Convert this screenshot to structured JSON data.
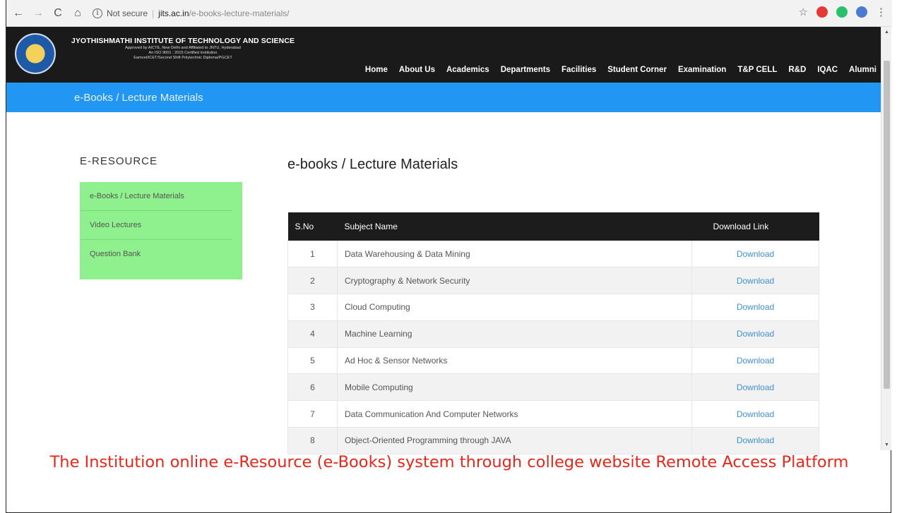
{
  "browser": {
    "security_label": "Not secure",
    "host": "jits.ac.in",
    "path": "/e-books-lecture-materials/"
  },
  "header": {
    "institute_name": "JYOTHISHMATHI INSTITUTE OF TECHNOLOGY AND SCIENCE",
    "lines": [
      "Approved by AICTE, New Delhi and Affiliated to JNTU, Hyderabad",
      "An ISO 9001 : 2015 Certified Institution",
      "Eamcet/ICET/Second Shift Polytechnic Diploma/PGCET"
    ],
    "menu": [
      "Home",
      "About Us",
      "Academics",
      "Departments",
      "Facilities",
      "Student Corner",
      "Examination",
      "T&P CELL",
      "R&D",
      "IQAC",
      "Alumni"
    ]
  },
  "banner": {
    "title": "e-Books / Lecture Materials"
  },
  "sidebar": {
    "title": "E-RESOURCE",
    "items": [
      "e-Books / Lecture Materials",
      "Video Lectures",
      "Question Bank"
    ]
  },
  "main": {
    "title": "e-books / Lecture Materials",
    "columns": [
      "S.No",
      "Subject Name",
      "Download Link"
    ],
    "rows": [
      {
        "no": "1",
        "subject": "Data Warehousing & Data Mining",
        "link": "Download"
      },
      {
        "no": "2",
        "subject": "Cryptography & Network Security",
        "link": "Download"
      },
      {
        "no": "3",
        "subject": "Cloud Computing",
        "link": "Download"
      },
      {
        "no": "4",
        "subject": "Machine Learning",
        "link": "Download"
      },
      {
        "no": "5",
        "subject": "Ad Hoc & Sensor Networks",
        "link": "Download"
      },
      {
        "no": "6",
        "subject": "Mobile Computing",
        "link": "Download"
      },
      {
        "no": "7",
        "subject": "Data Communication And Computer Networks",
        "link": "Download"
      },
      {
        "no": "8",
        "subject": "Object-Oriented Programming through JAVA",
        "link": "Download"
      }
    ]
  },
  "caption": "The Institution online e-Resource (e-Books) system through college website Remote Access Platform",
  "colors": {
    "banner": "#2196f3",
    "sidebar": "#8ef18e",
    "caption": "#e8261b",
    "header": "#1a1a1a"
  }
}
